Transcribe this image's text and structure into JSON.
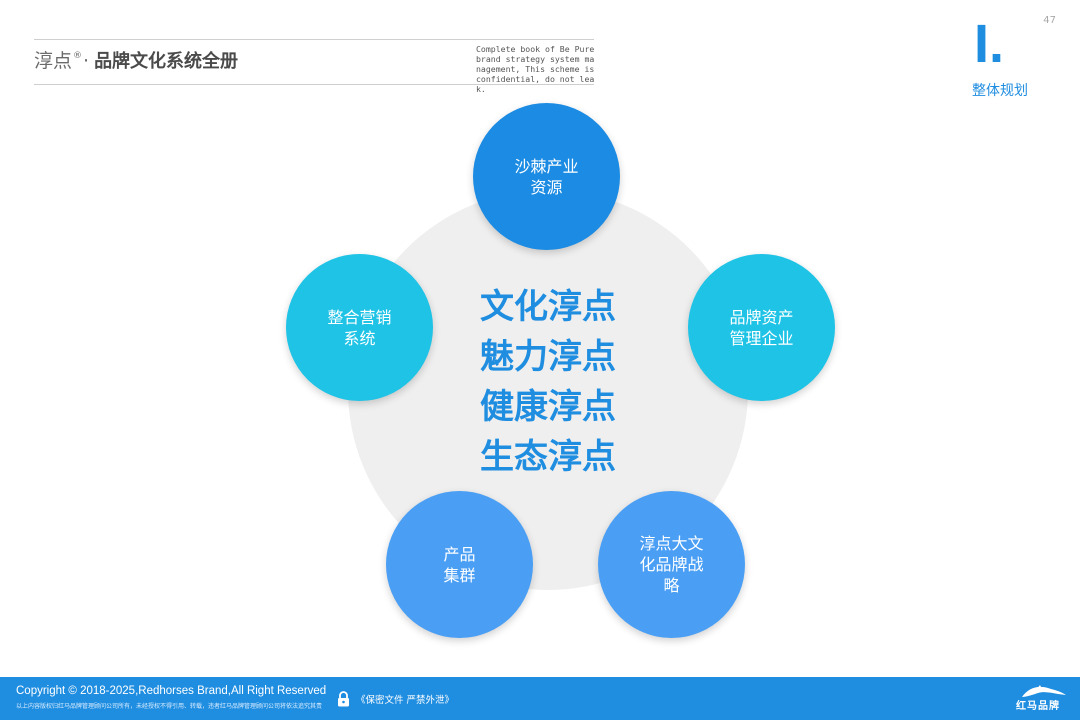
{
  "header": {
    "brand": "淳点",
    "registered_mark": "®",
    "separator": "·",
    "title": "品牌文化系统全册",
    "confidential_note": "Complete book of Be Pure brand strategy system management, This scheme is confidential, do not leak."
  },
  "page_number": "47",
  "section": {
    "number": "I.",
    "label": "整体规划"
  },
  "diagram": {
    "center_lines": [
      "文化淳点",
      "魅力淳点",
      "健康淳点",
      "生态淳点"
    ],
    "nodes": [
      {
        "lines": [
          "沙棘产业",
          "资源"
        ],
        "color": "#1b8be3"
      },
      {
        "lines": [
          "品牌资产",
          "管理企业"
        ],
        "color": "#1ec3e6"
      },
      {
        "lines": [
          "淳点大文",
          "化品牌战",
          "略"
        ],
        "color": "#4a9ff5"
      },
      {
        "lines": [
          "产品",
          "集群"
        ],
        "color": "#4a9ff5"
      },
      {
        "lines": [
          "整合营销",
          "系统"
        ],
        "color": "#1ec3e6"
      }
    ]
  },
  "footer": {
    "copyright": "Copyright © 2018-2025,Redhorses Brand,All Right Reserved",
    "note": "以上内容版权归红马品牌管理顾问公司所有，未经授权不得引用、转载，违者红马品牌管理顾问公司将依法追究其责",
    "secret_label": "《保密文件 严禁外泄》",
    "logo_text": "红马品牌"
  },
  "colors": {
    "accent": "#1f8de0",
    "footer_bg": "#1f8de0",
    "center_bg": "#efefef"
  }
}
